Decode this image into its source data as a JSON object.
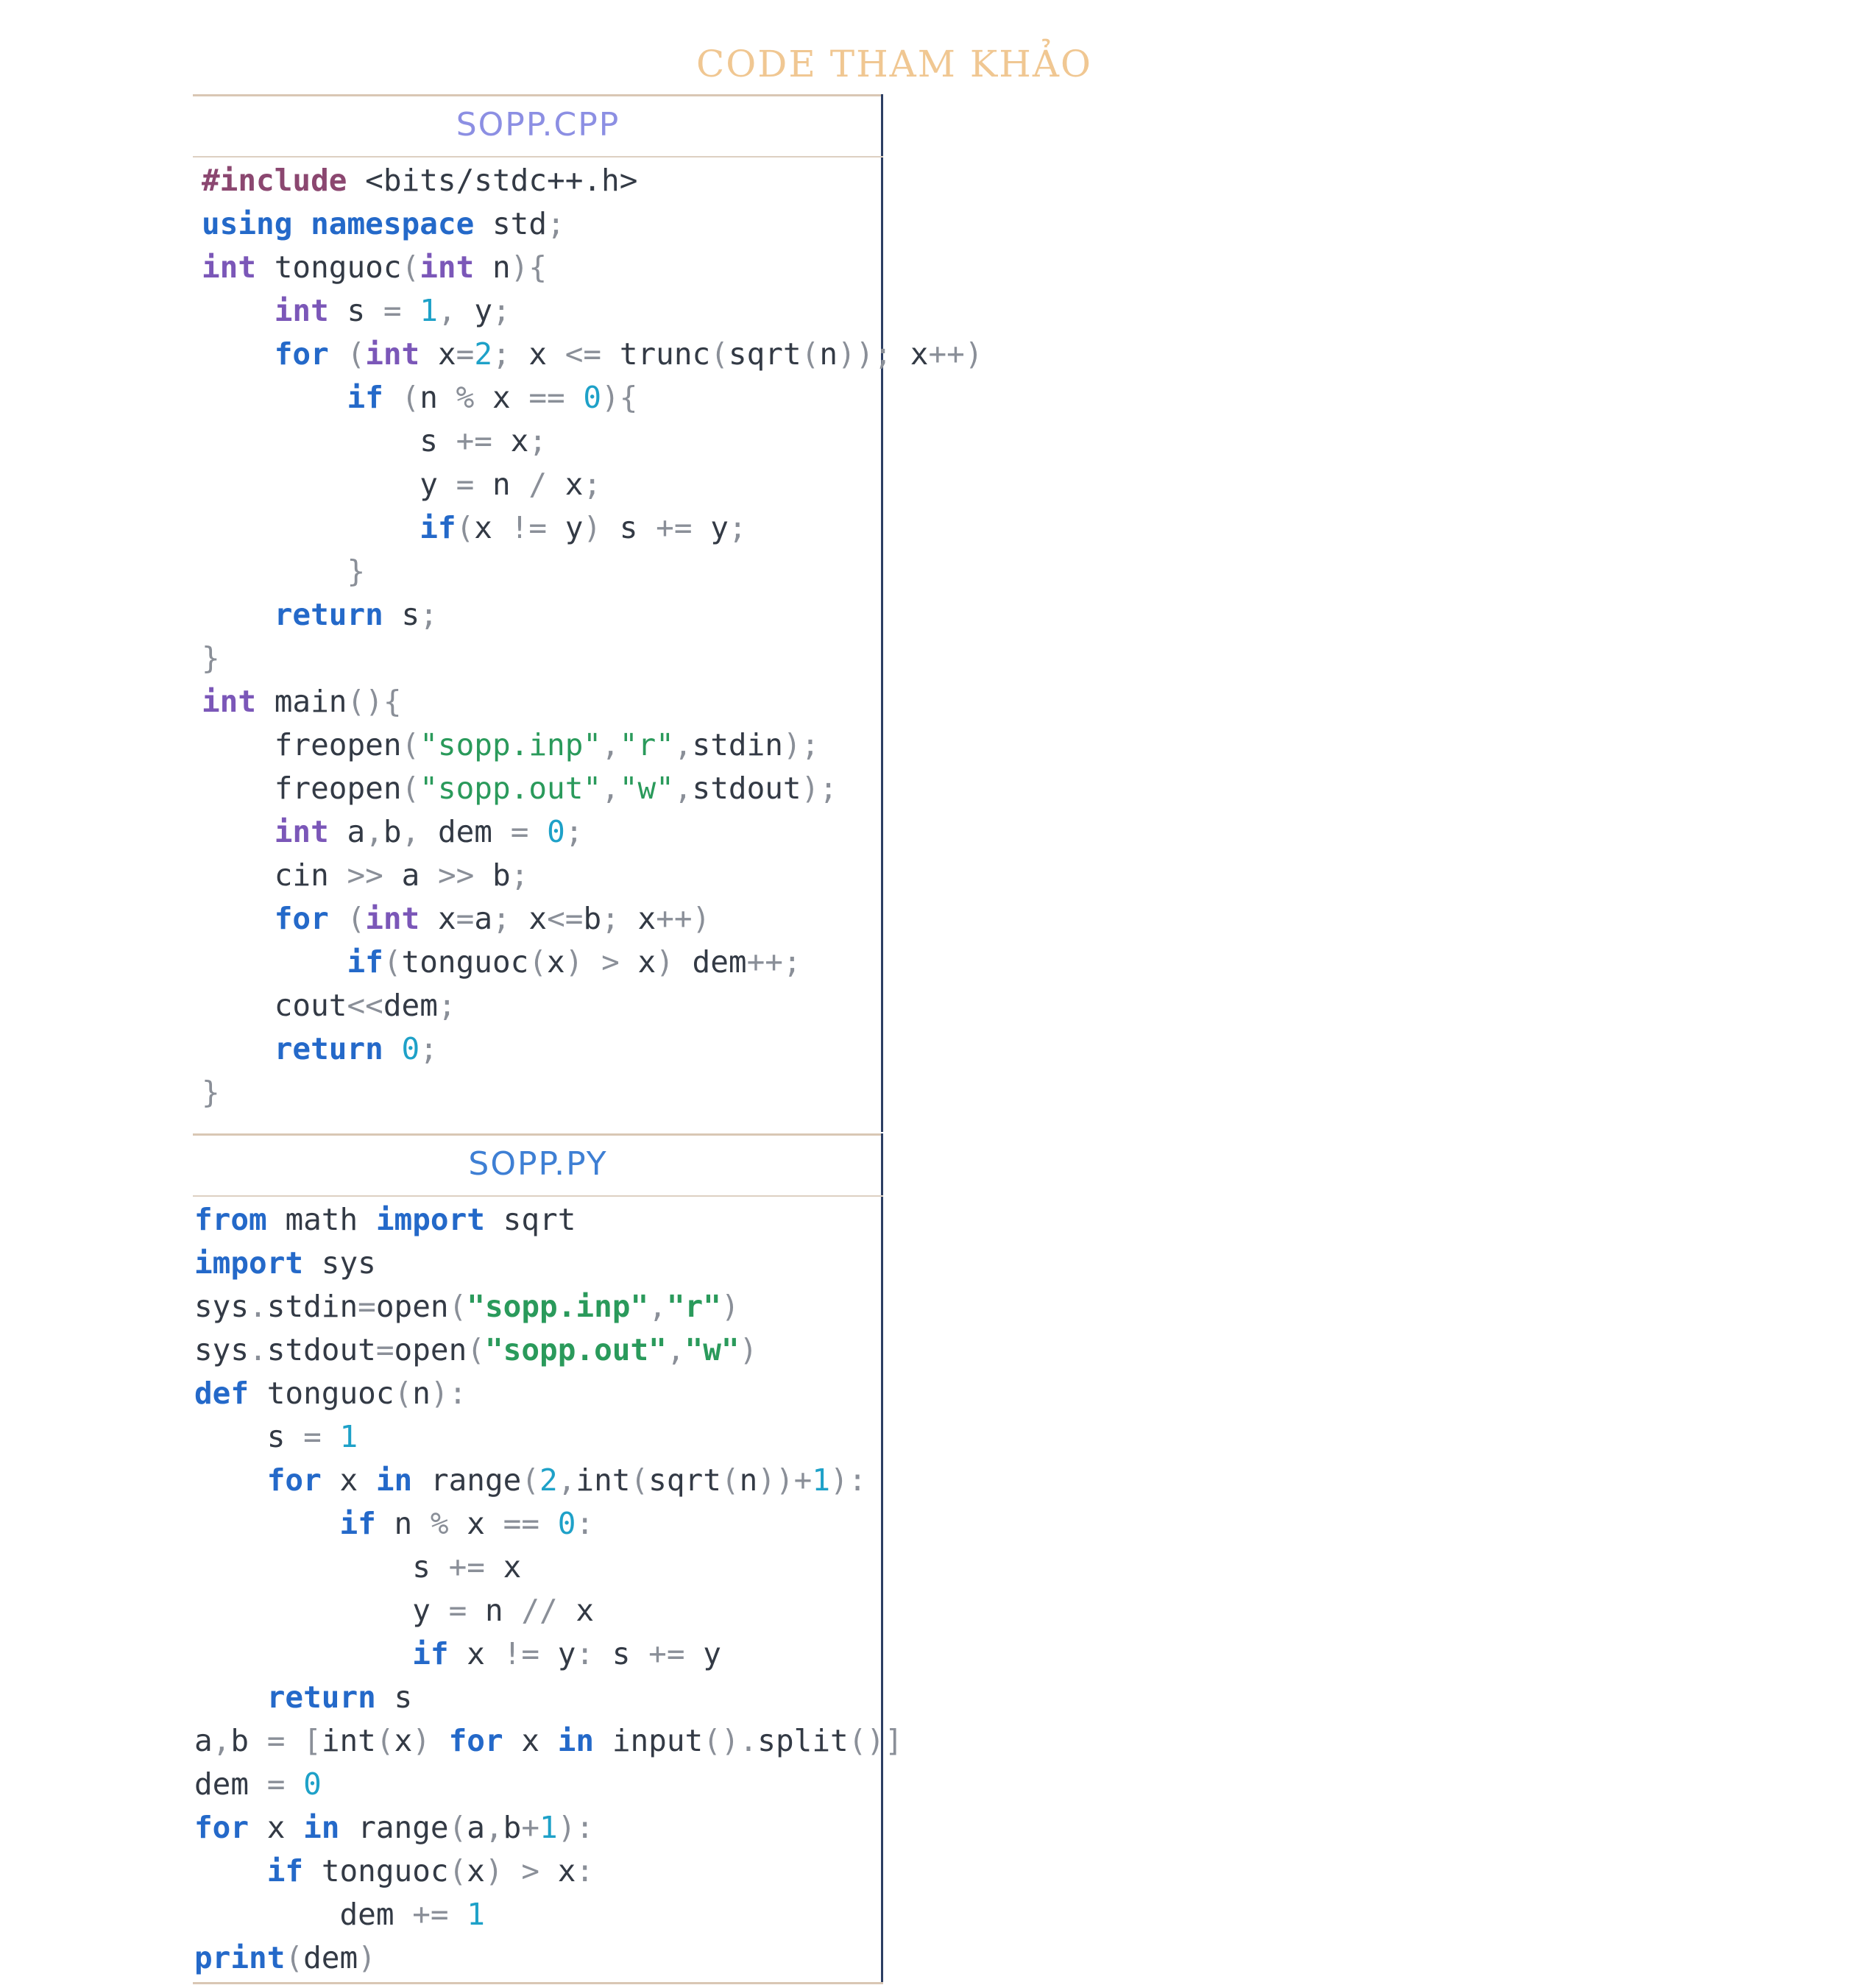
{
  "page_title": "CODE THAM KHẢO",
  "cpp": {
    "filename": "SOPP.CPP",
    "lines": [
      "#include <bits/stdc++.h>",
      "using namespace std;",
      "int tonguoc(int n){",
      "    int s = 1, y;",
      "    for (int x=2; x <= trunc(sqrt(n)); x++)",
      "        if (n % x == 0){",
      "            s += x;",
      "            y = n / x;",
      "            if(x != y) s += y;",
      "        }",
      "    return s;",
      "}",
      "int main(){",
      "    freopen(\"sopp.inp\",\"r\",stdin);",
      "    freopen(\"sopp.out\",\"w\",stdout);",
      "    int a,b, dem = 0;",
      "    cin >> a >> b;",
      "    for (int x=a; x<=b; x++)",
      "        if(tonguoc(x) > x) dem++;",
      "    cout<<dem;",
      "    return 0;",
      "}"
    ]
  },
  "py": {
    "filename": "SOPP.PY",
    "lines": [
      "from math import sqrt",
      "import sys",
      "sys.stdin=open(\"sopp.inp\",\"r\")",
      "sys.stdout=open(\"sopp.out\",\"w\")",
      "def tonguoc(n):",
      "    s = 1",
      "    for x in range(2,int(sqrt(n))+1):",
      "        if n % x == 0:",
      "            s += x",
      "            y = n // x",
      "            if x != y: s += y",
      "    return s",
      "a,b = [int(x) for x in input().split()]",
      "dem = 0",
      "for x in range(a,b+1):",
      "    if tonguoc(x) > x:",
      "        dem += 1",
      "print(dem)"
    ]
  },
  "colors": {
    "title": "#f0c792",
    "cpp_filename": "#8c8fe3",
    "py_filename": "#3e7fd4",
    "keyword": "#2469c9",
    "preprocessor": "#8b4770",
    "type": "#7b57b8",
    "number": "#1ea1c8",
    "string": "#2a9a5b",
    "operator": "#8a8f98",
    "text": "#333a45"
  }
}
